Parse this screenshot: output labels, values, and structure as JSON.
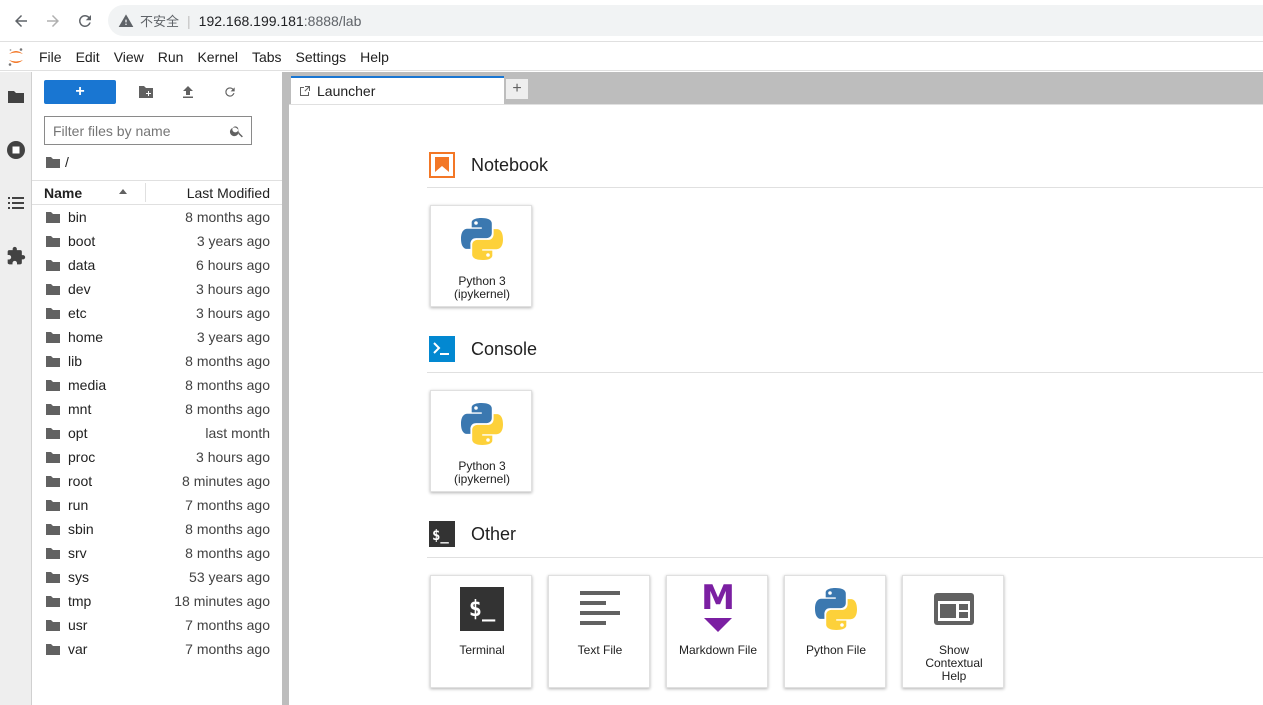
{
  "browser": {
    "insecure_label": "不安全",
    "separator": "|",
    "url_host": "192.168.199.181",
    "url_rest": ":8888/lab"
  },
  "menubar": {
    "items": [
      "File",
      "Edit",
      "View",
      "Run",
      "Kernel",
      "Tabs",
      "Settings",
      "Help"
    ]
  },
  "filebrowser": {
    "new_label": "+",
    "filter_placeholder": "Filter files by name",
    "breadcrumb": "/",
    "header": {
      "name": "Name",
      "modified": "Last Modified"
    },
    "files": [
      {
        "name": "bin",
        "modified": "8 months ago"
      },
      {
        "name": "boot",
        "modified": "3 years ago"
      },
      {
        "name": "data",
        "modified": "6 hours ago"
      },
      {
        "name": "dev",
        "modified": "3 hours ago"
      },
      {
        "name": "etc",
        "modified": "3 hours ago"
      },
      {
        "name": "home",
        "modified": "3 years ago"
      },
      {
        "name": "lib",
        "modified": "8 months ago"
      },
      {
        "name": "media",
        "modified": "8 months ago"
      },
      {
        "name": "mnt",
        "modified": "8 months ago"
      },
      {
        "name": "opt",
        "modified": "last month"
      },
      {
        "name": "proc",
        "modified": "3 hours ago"
      },
      {
        "name": "root",
        "modified": "8 minutes ago"
      },
      {
        "name": "run",
        "modified": "7 months ago"
      },
      {
        "name": "sbin",
        "modified": "8 months ago"
      },
      {
        "name": "srv",
        "modified": "8 months ago"
      },
      {
        "name": "sys",
        "modified": "53 years ago"
      },
      {
        "name": "tmp",
        "modified": "18 minutes ago"
      },
      {
        "name": "usr",
        "modified": "7 months ago"
      },
      {
        "name": "var",
        "modified": "7 months ago"
      }
    ]
  },
  "tabs": {
    "active_label": "Launcher",
    "add_label": "+"
  },
  "launcher": {
    "notebook": {
      "title": "Notebook",
      "cards": [
        {
          "line1": "Python 3",
          "line2": "(ipykernel)"
        }
      ]
    },
    "console": {
      "title": "Console",
      "cards": [
        {
          "line1": "Python 3",
          "line2": "(ipykernel)"
        }
      ]
    },
    "other": {
      "title": "Other",
      "terminal_icon_text": "$_",
      "markdown_icon_text": "M",
      "cards": [
        {
          "label": "Terminal"
        },
        {
          "label": "Text File"
        },
        {
          "label": "Markdown File"
        },
        {
          "label": "Python File"
        },
        {
          "line1": "Show",
          "line2": "Contextual",
          "line3": "Help"
        }
      ]
    }
  },
  "colors": {
    "brand_blue": "#1976d2",
    "jupyter_orange": "#f37726",
    "markdown_purple": "#7b1fa2",
    "console_blue": "#0288d1"
  }
}
